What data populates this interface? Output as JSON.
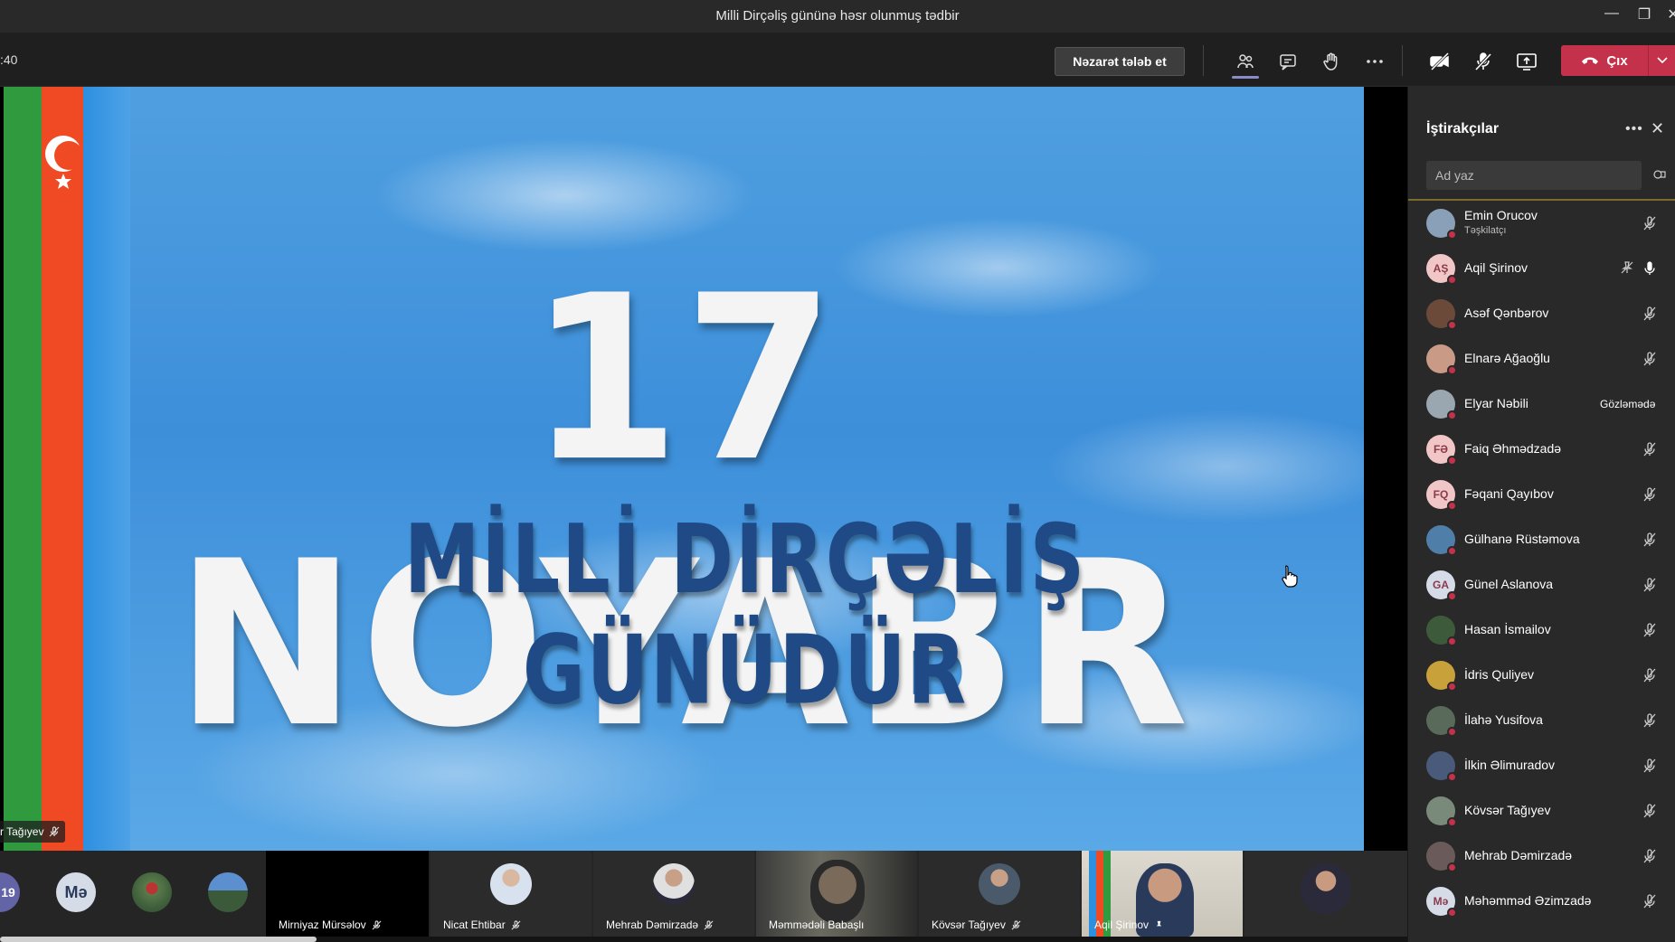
{
  "window": {
    "title": "Milli Dirçəliş gününə həsr olunmuş tədbir"
  },
  "toolbar": {
    "timer": ":40",
    "request_control_label": "Nəzarət tələb et",
    "leave_label": "Çıx"
  },
  "stage": {
    "headline": "17 NOYABR",
    "subheadline": "MİLLİ DİRÇƏLİŞ GÜNÜDÜR",
    "speaker_label": "r Tağıyev"
  },
  "strip": {
    "count_badge": "19",
    "initials_avatar": "Mə",
    "tiles": [
      {
        "name": "Mirniyaz Mürsəlov"
      },
      {
        "name": "Nicat Ehtibar"
      },
      {
        "name": "Mehrab Dəmirzadə"
      },
      {
        "name": "Məmmədəli Babaşlı"
      },
      {
        "name": "Kövsər Tağıyev"
      },
      {
        "name": "Aqil Şirinov"
      }
    ]
  },
  "panel": {
    "title": "İştirakçılar",
    "search_placeholder": "Ad yaz",
    "participants": [
      {
        "name": "Emin Orucov",
        "role": "Təşkilatçı",
        "initials": "",
        "color": "#8aa0b8",
        "status": "",
        "mic": "muted"
      },
      {
        "name": "Aqil Şirinov",
        "role": "",
        "initials": "AŞ",
        "color": "#f1c6c6",
        "status": "",
        "mic": "on"
      },
      {
        "name": "Asəf Qənbərov",
        "role": "",
        "initials": "",
        "color": "#6b4a3a",
        "status": "",
        "mic": "muted"
      },
      {
        "name": "Elnarə Ağaoğlu",
        "role": "",
        "initials": "",
        "color": "#c99a86",
        "status": "",
        "mic": "muted"
      },
      {
        "name": "Elyar Nəbili",
        "role": "",
        "initials": "",
        "color": "#9aa6b0",
        "status": "Gözləmədə",
        "mic": "none"
      },
      {
        "name": "Faiq Əhmədzadə",
        "role": "",
        "initials": "FƏ",
        "color": "#f1c6c6",
        "status": "",
        "mic": "muted"
      },
      {
        "name": "Fəqani Qayıbov",
        "role": "",
        "initials": "FQ",
        "color": "#f1c6c6",
        "status": "",
        "mic": "muted"
      },
      {
        "name": "Gülhanə Rüstəmova",
        "role": "",
        "initials": "",
        "color": "#4f7fa8",
        "status": "",
        "mic": "muted"
      },
      {
        "name": "Günel Aslanova",
        "role": "",
        "initials": "GA",
        "color": "#d6dbe8",
        "status": "",
        "mic": "muted"
      },
      {
        "name": "Hasan İsmailov",
        "role": "",
        "initials": "",
        "color": "#3d5a3a",
        "status": "",
        "mic": "muted"
      },
      {
        "name": "İdris Quliyev",
        "role": "",
        "initials": "",
        "color": "#c8a13a",
        "status": "",
        "mic": "muted"
      },
      {
        "name": "İlahə Yusifova",
        "role": "",
        "initials": "",
        "color": "#5a6a5a",
        "status": "",
        "mic": "muted"
      },
      {
        "name": "İlkin Əlimuradov",
        "role": "",
        "initials": "",
        "color": "#4a5a7a",
        "status": "",
        "mic": "muted"
      },
      {
        "name": "Kövsər Tağıyev",
        "role": "",
        "initials": "",
        "color": "#7a8a7a",
        "status": "",
        "mic": "muted"
      },
      {
        "name": "Mehrab Dəmirzadə",
        "role": "",
        "initials": "",
        "color": "#6a5a5a",
        "status": "",
        "mic": "muted"
      },
      {
        "name": "Məhəmməd Əzimzadə",
        "role": "",
        "initials": "Mə",
        "color": "#d6dbe8",
        "status": "",
        "mic": "muted"
      }
    ]
  },
  "colors": {
    "leave": "#c4314b",
    "accent": "#8b8cc7",
    "panel_bg": "#292929"
  }
}
